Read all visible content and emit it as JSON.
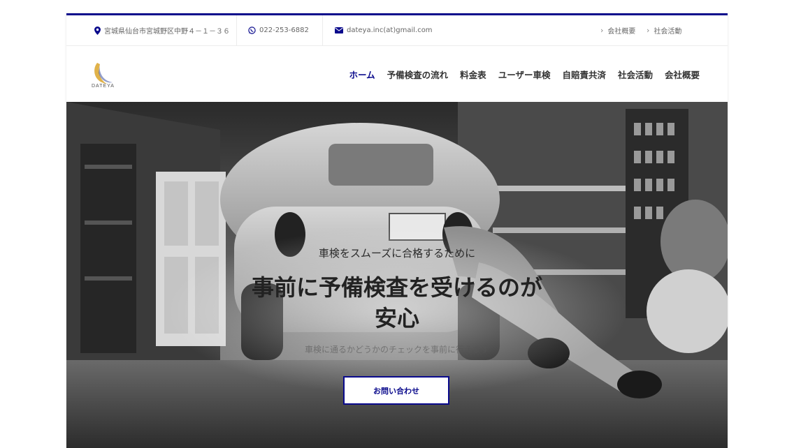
{
  "topbar": {
    "address": "宮城県仙台市宮城野区中野４－１－３６",
    "phone": "022-253-6882",
    "email": "dateya.inc(at)gmail.com",
    "links": [
      {
        "label": "会社概要"
      },
      {
        "label": "社会活動"
      }
    ]
  },
  "header": {
    "logo_text": "DATEYA",
    "nav": [
      {
        "label": "ホーム",
        "active": true
      },
      {
        "label": "予備検査の流れ"
      },
      {
        "label": "料金表"
      },
      {
        "label": "ユーザー車検"
      },
      {
        "label": "自賠責共済"
      },
      {
        "label": "社会活動"
      },
      {
        "label": "会社概要"
      }
    ]
  },
  "hero": {
    "subtitle": "車検をスムーズに合格するために",
    "title": "事前に予備検査を受けるのが安心",
    "description": "車検に通るかどうかのチェックを事前に行えます",
    "cta_label": "お問い合わせ"
  },
  "colors": {
    "accent": "#0a0a8c",
    "text": "#333333"
  }
}
